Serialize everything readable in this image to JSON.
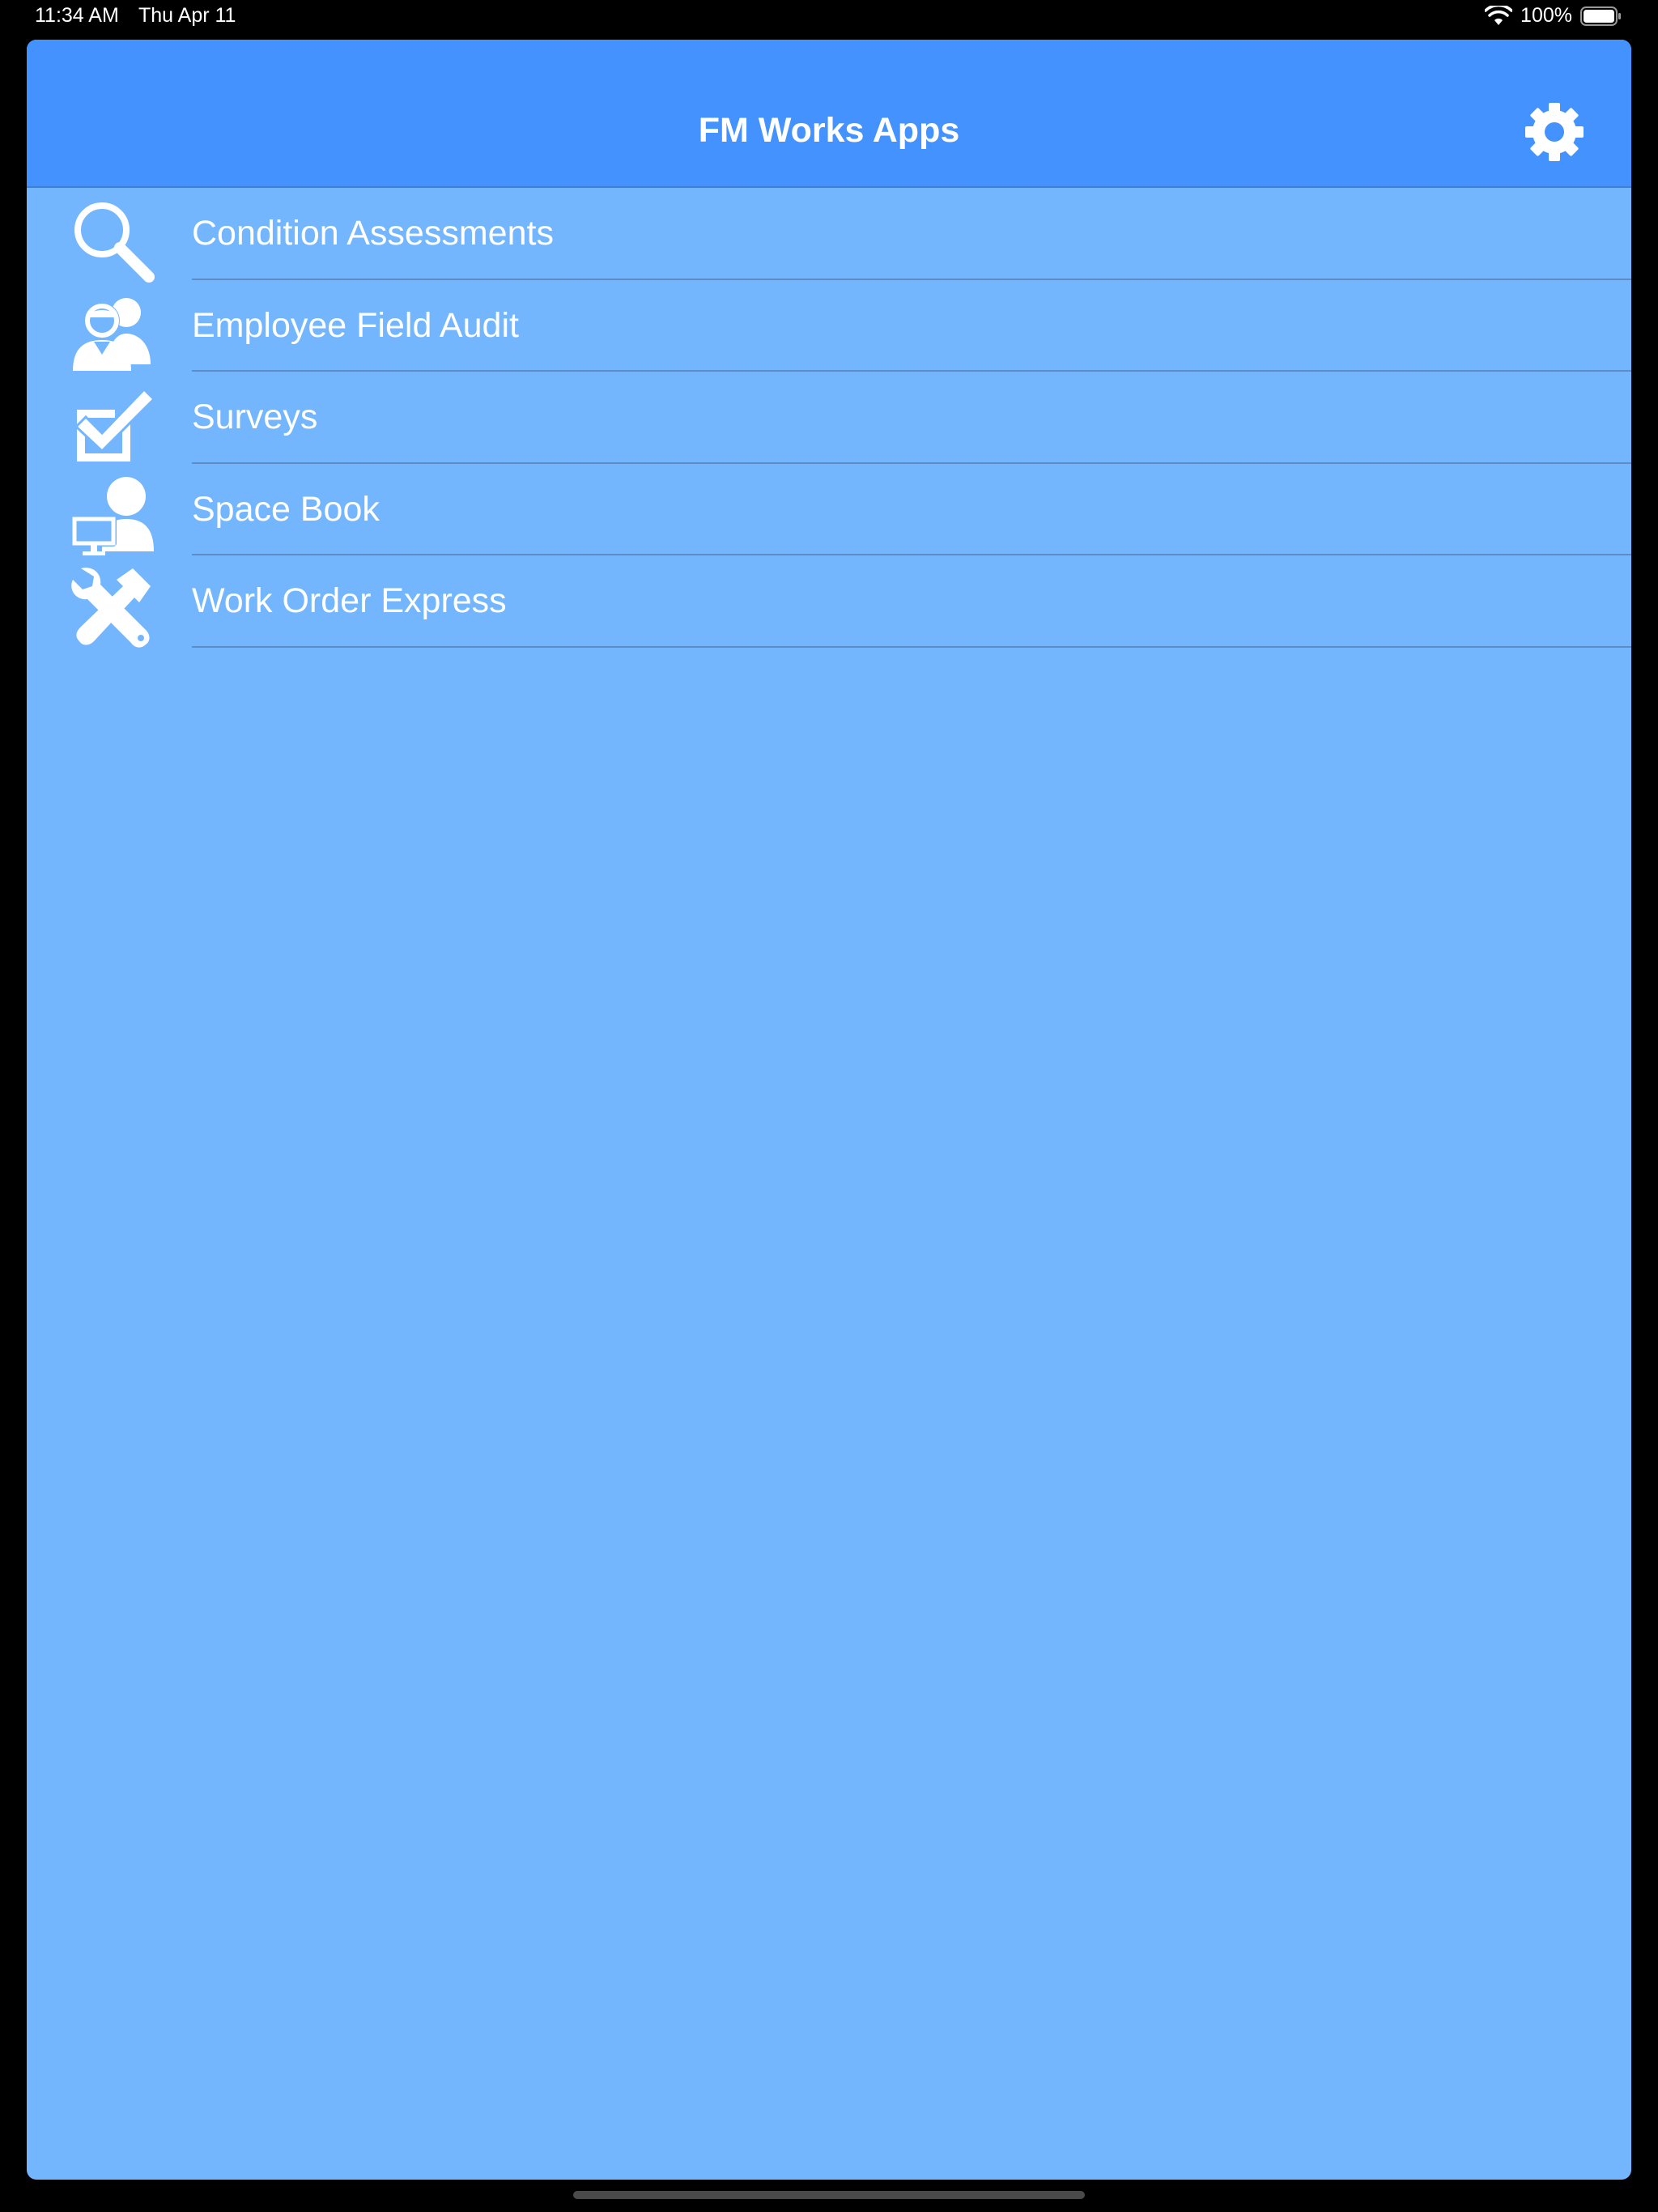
{
  "status_bar": {
    "time": "11:34 AM",
    "date": "Thu Apr 11",
    "battery_percent": "100%",
    "wifi_icon": "wifi-icon",
    "battery_icon": "battery-icon",
    "battery_level": 1.0
  },
  "nav": {
    "title": "FM Works Apps",
    "settings_icon": "gear-icon"
  },
  "apps": [
    {
      "label": "Condition Assessments",
      "icon": "magnifier-icon"
    },
    {
      "label": "Employee Field Audit",
      "icon": "people-icon"
    },
    {
      "label": "Surveys",
      "icon": "checkbox-icon"
    },
    {
      "label": "Space Book",
      "icon": "person-monitor-icon"
    },
    {
      "label": "Work Order Express",
      "icon": "wrench-hammer-icon"
    }
  ],
  "colors": {
    "nav_background": "#4492fd",
    "content_background": "#74b6fd",
    "text": "#ffffff"
  }
}
